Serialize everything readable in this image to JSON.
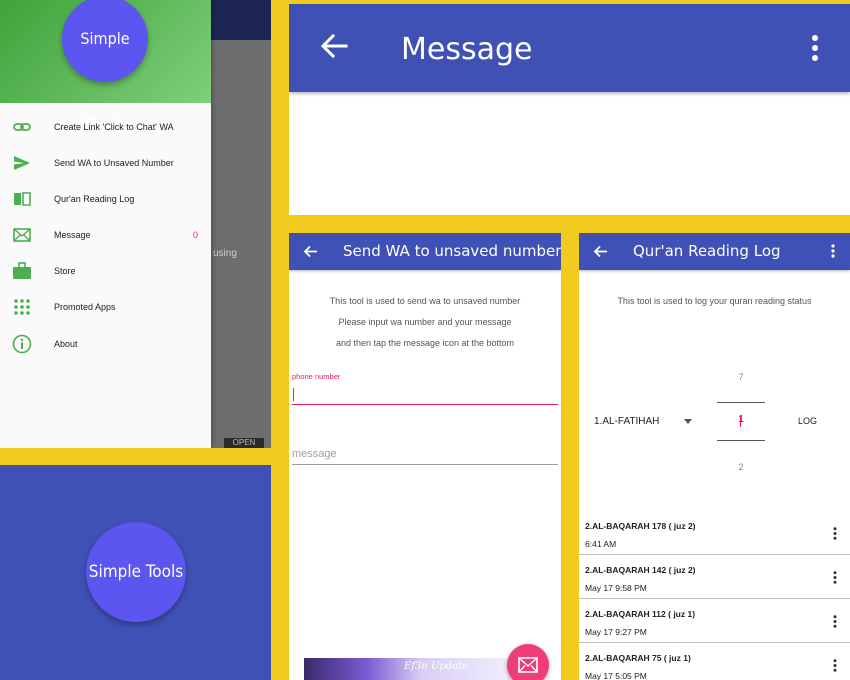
{
  "drawer": {
    "logo_text": "Simple Tools",
    "background_text": "using",
    "background_button": "OPEN",
    "items": [
      {
        "label": "Create Link 'Click to Chat' WA",
        "icon": "link-icon"
      },
      {
        "label": "Send WA to Unsaved Number",
        "icon": "send-icon"
      },
      {
        "label": "Qur'an Reading Log",
        "icon": "book-icon"
      },
      {
        "label": "Message",
        "icon": "mail-icon",
        "count": "0"
      },
      {
        "label": "Store",
        "icon": "store-icon"
      },
      {
        "label": "Promoted Apps",
        "icon": "apps-grid-icon"
      },
      {
        "label": "About",
        "icon": "info-icon"
      }
    ]
  },
  "splash": {
    "logo_text": "Simple Tools"
  },
  "message_screen": {
    "title": "Message"
  },
  "send_wa": {
    "title": "Send WA to unsaved number",
    "desc_lines": [
      "This tool is used to send wa to unsaved number",
      "Please input wa number and your message",
      "and then tap the message icon at the bottom"
    ],
    "phone_label": "phone number",
    "phone_value": "",
    "message_placeholder": "message",
    "ad_text": "Ef3n Update"
  },
  "quran_log": {
    "title": "Qur'an Reading Log",
    "desc": "This tool is used to log your quran reading status",
    "surah_selected": "1.AL-FATIHAH",
    "picker": {
      "above": "7",
      "current": "1",
      "below": "2"
    },
    "log_button": "LOG",
    "entries": [
      {
        "title": "2.AL-BAQARAH 178 ( juz 2)",
        "time": "6:41 AM"
      },
      {
        "title": "2.AL-BAQARAH 142 ( juz 2)",
        "time": "May 17 9:58 PM"
      },
      {
        "title": "2.AL-BAQARAH 112 ( juz 1)",
        "time": "May 17 9:27 PM"
      },
      {
        "title": "2.AL-BAQARAH 75 ( juz 1)",
        "time": "May 17 5:05 PM"
      }
    ]
  },
  "colors": {
    "primary": "#3f51b5",
    "accent": "#e91e63",
    "background": "#f1cb1e",
    "drawer_header": "#4caf50",
    "logo_circle": "#5b56ef"
  }
}
